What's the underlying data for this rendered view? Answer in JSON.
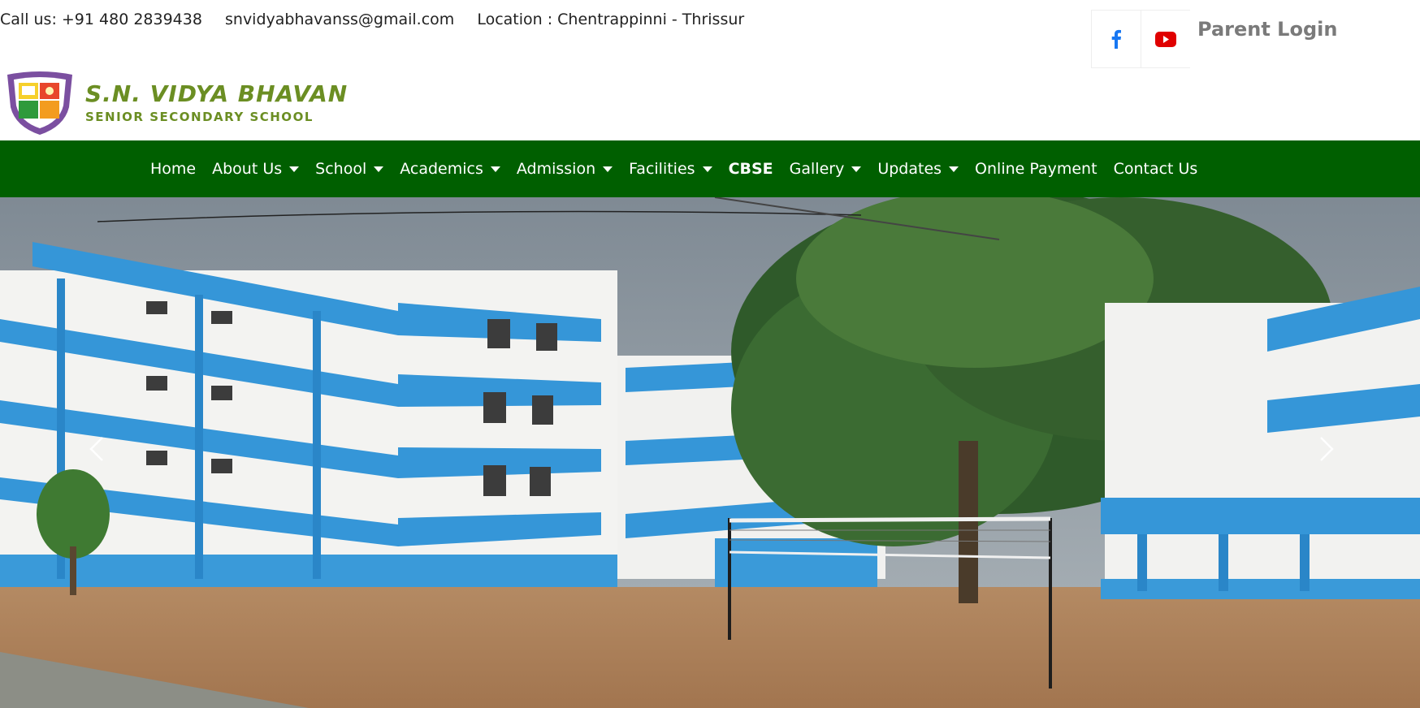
{
  "topbar": {
    "phone": "Call us: +91 480 2839438",
    "email": "snvidyabhavanss@gmail.com",
    "location": "Location : Chentrappinni - Thrissur"
  },
  "social": {
    "facebook_icon": "facebook-icon",
    "youtube_icon": "youtube-icon",
    "parent_login": "Parent Login"
  },
  "logo": {
    "title": "S.N. VIDYA BHAVAN",
    "subtitle": "SENIOR SECONDARY SCHOOL"
  },
  "nav": {
    "items": [
      {
        "label": "Home",
        "dropdown": false
      },
      {
        "label": "About Us",
        "dropdown": true
      },
      {
        "label": "School",
        "dropdown": true
      },
      {
        "label": "Academics",
        "dropdown": true
      },
      {
        "label": "Admission",
        "dropdown": true
      },
      {
        "label": "Facilities",
        "dropdown": true
      },
      {
        "label": "CBSE",
        "dropdown": false
      },
      {
        "label": "Gallery",
        "dropdown": true
      },
      {
        "label": "Updates",
        "dropdown": true
      },
      {
        "label": "Online Payment",
        "dropdown": false
      },
      {
        "label": "Contact Us",
        "dropdown": false
      }
    ]
  },
  "carousel": {
    "prev_icon": "chevron-left-icon",
    "next_icon": "chevron-right-icon"
  },
  "colors": {
    "nav_bg": "#005f00",
    "logo_green": "#6b8e23",
    "building_blue": "#3a9ad9"
  }
}
